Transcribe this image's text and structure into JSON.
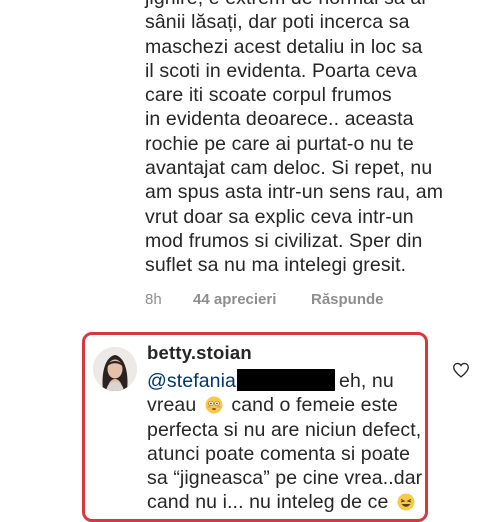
{
  "parent_comment": {
    "lines": [
      "jignire, e extrem de normal sa ai",
      "sânii lăsați, dar poti incerca sa",
      "maschezi acest detaliu in loc sa",
      "il scoti in evidenta. Poarta ceva",
      "care iti scoate corpul frumos",
      "in evidenta deoarece.. aceasta",
      "rochie pe care ai purtat-o nu te",
      "avantajat cam deloc. Si repet, nu",
      "am spus asta intr-un sens rau, am",
      "vrut doar sa explic ceva intr-un",
      "mod frumos si civilizat. Sper din",
      "suflet sa nu ma intelegi gresit."
    ],
    "time": "8h",
    "likes": "44 aprecieri",
    "reply_label": "Răspunde"
  },
  "reply": {
    "username": "betty.stoian",
    "mention": "@stefania",
    "line1_after": "eh, nu",
    "line2_before": "vreau",
    "line2_after": "cand o femeie este",
    "lines": [
      "perfecta si nu are niciun defect,",
      "atunci poate comenta si poate",
      "sa “jigneasca” pe cine vrea..dar"
    ],
    "last_line": "cand nu i... nu inteleg de ce",
    "emoji_1": "flushed-face-emoji",
    "emoji_2": "laughing-face-emoji"
  },
  "colors": {
    "highlight_border": "#d6383f",
    "mention": "#00376b",
    "meta": "#8e8e8e"
  }
}
